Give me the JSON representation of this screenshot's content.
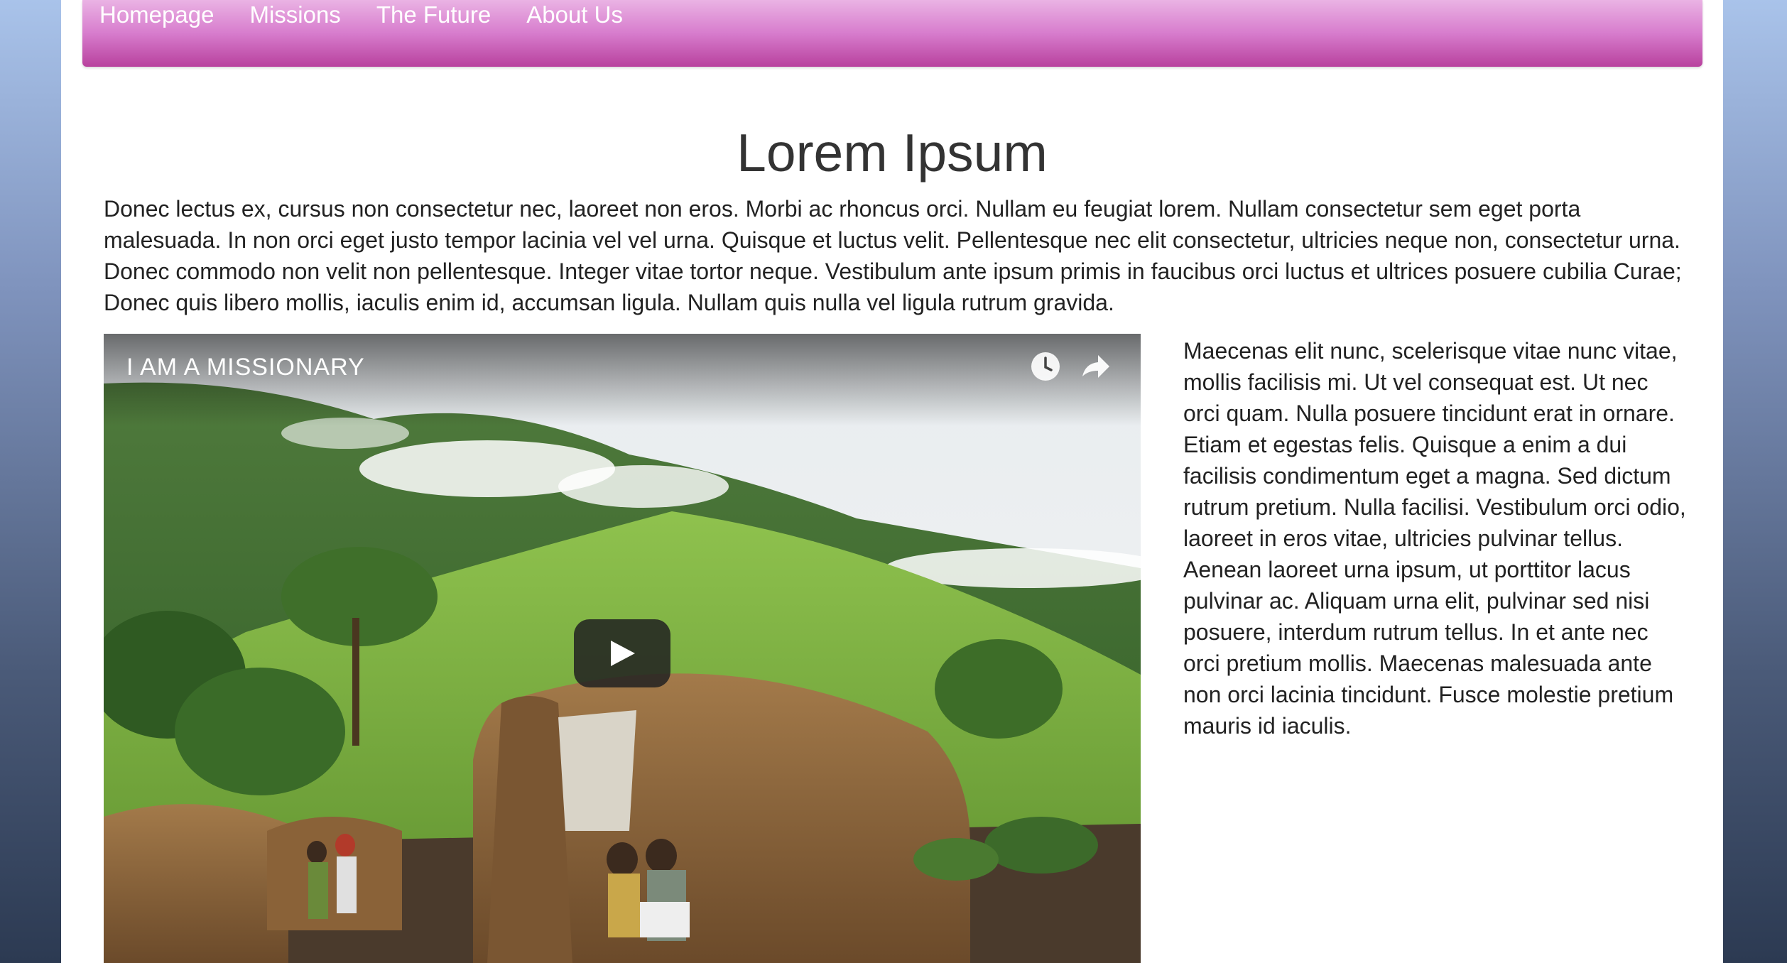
{
  "nav": {
    "items": [
      {
        "label": "Homepage"
      },
      {
        "label": "Missions"
      },
      {
        "label": "The Future"
      },
      {
        "label": "About Us"
      }
    ]
  },
  "main": {
    "title": "Lorem Ipsum",
    "intro": "Donec lectus ex, cursus non consectetur nec, laoreet non eros. Morbi ac rhoncus orci. Nullam eu feugiat lorem. Nullam consectetur sem eget porta malesuada. In non orci eget justo tempor lacinia vel vel urna. Quisque et luctus velit. Pellentesque nec elit consectetur, ultricies neque non, consectetur urna. Donec commodo non velit non pellentesque. Integer vitae tortor neque. Vestibulum ante ipsum primis in faucibus orci luctus et ultrices posuere cubilia Curae; Donec quis libero mollis, iaculis enim id, accumsan ligula. Nullam quis nulla vel ligula rutrum gravida.",
    "side_text": "Maecenas elit nunc, scelerisque vitae nunc vitae, mollis facilisis mi. Ut vel consequat est. Ut nec orci quam. Nulla posuere tincidunt erat in ornare. Etiam et egestas felis. Quisque a enim a dui facilisis condimentum eget a magna. Sed dictum rutrum pretium. Nulla facilisi. Vestibulum orci odio, laoreet in eros vitae, ultricies pulvinar tellus. Aenean laoreet urna ipsum, ut porttitor lacus pulvinar ac. Aliquam urna elit, pulvinar sed nisi posuere, interdum rutrum tellus. In et ante nec orci pretium mollis. Maecenas malesuada ante non orci lacinia tincidunt. Fusce molestie pretium mauris id iaculis."
  },
  "video": {
    "title": "I AM A MISSIONARY",
    "icons": {
      "watch_later": "clock-icon",
      "share": "share-icon",
      "play": "play-icon"
    }
  },
  "colors": {
    "nav_top": "#eab3e4",
    "nav_bottom": "#b8419e",
    "background_top": "#a9c3ea",
    "background_bottom": "#2c3a52"
  }
}
